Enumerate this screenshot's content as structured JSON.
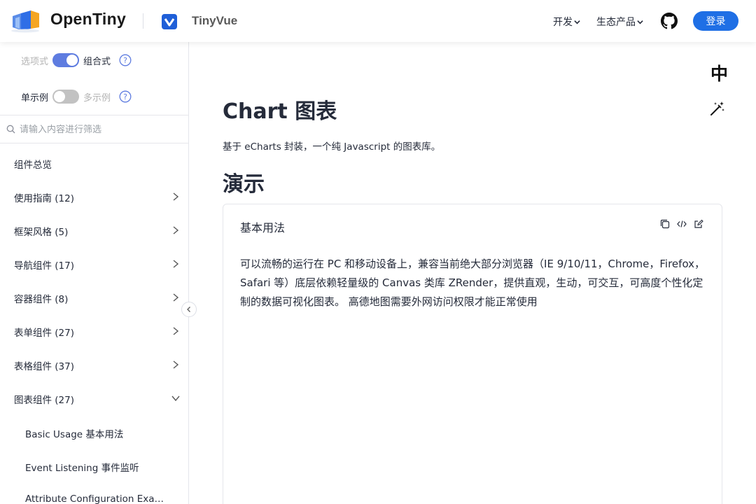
{
  "header": {
    "brand": "OpenTiny",
    "product": "TinyVue",
    "nav": [
      {
        "label": "开发"
      },
      {
        "label": "生态产品"
      }
    ],
    "login_label": "登录",
    "icons": {
      "logo": "opentiny-logo-icon",
      "product": "tinyvue-logo-icon",
      "github": "github-icon"
    },
    "colors": {
      "accent": "#1f6fe5",
      "switch_on": "#5e7ce0"
    }
  },
  "sidebar": {
    "api_toggle": {
      "left": "选项式",
      "right": "组合式",
      "state": "on"
    },
    "example_toggle": {
      "left": "单示例",
      "right": "多示例",
      "state": "off"
    },
    "search_placeholder": "请输入内容进行筛选",
    "items": [
      {
        "label": "组件总览",
        "expandable": false
      },
      {
        "label": "使用指南 (12)",
        "expandable": true
      },
      {
        "label": "框架风格 (5)",
        "expandable": true
      },
      {
        "label": "导航组件 (17)",
        "expandable": true
      },
      {
        "label": "容器组件 (8)",
        "expandable": true
      },
      {
        "label": "表单组件 (27)",
        "expandable": true
      },
      {
        "label": "表格组件 (37)",
        "expandable": true
      },
      {
        "label": "图表组件 (27)",
        "expandable": true,
        "expanded": true
      }
    ],
    "sub_items": [
      {
        "label": "Basic Usage 基本用法"
      },
      {
        "label": "Event Listening 事件监听"
      },
      {
        "label": "Attribute Configuration Exam..."
      }
    ]
  },
  "main": {
    "lang_switch": "中",
    "title": "Chart 图表",
    "description": "基于 eCharts 封装，一个纯 Javascript 的图表库。",
    "section_title": "演示",
    "demo": {
      "title": "基本用法",
      "text": "可以流畅的运行在 PC 和移动设备上，兼容当前绝大部分浏览器（IE 9/10/11，Chrome，Firefox，Safari 等）底层依赖轻量级的 Canvas 类库 ZRender，提供直观，生动，可交互，可高度个性化定制的数据可视化图表。 高德地图需要外网访问权限才能正常使用"
    }
  }
}
